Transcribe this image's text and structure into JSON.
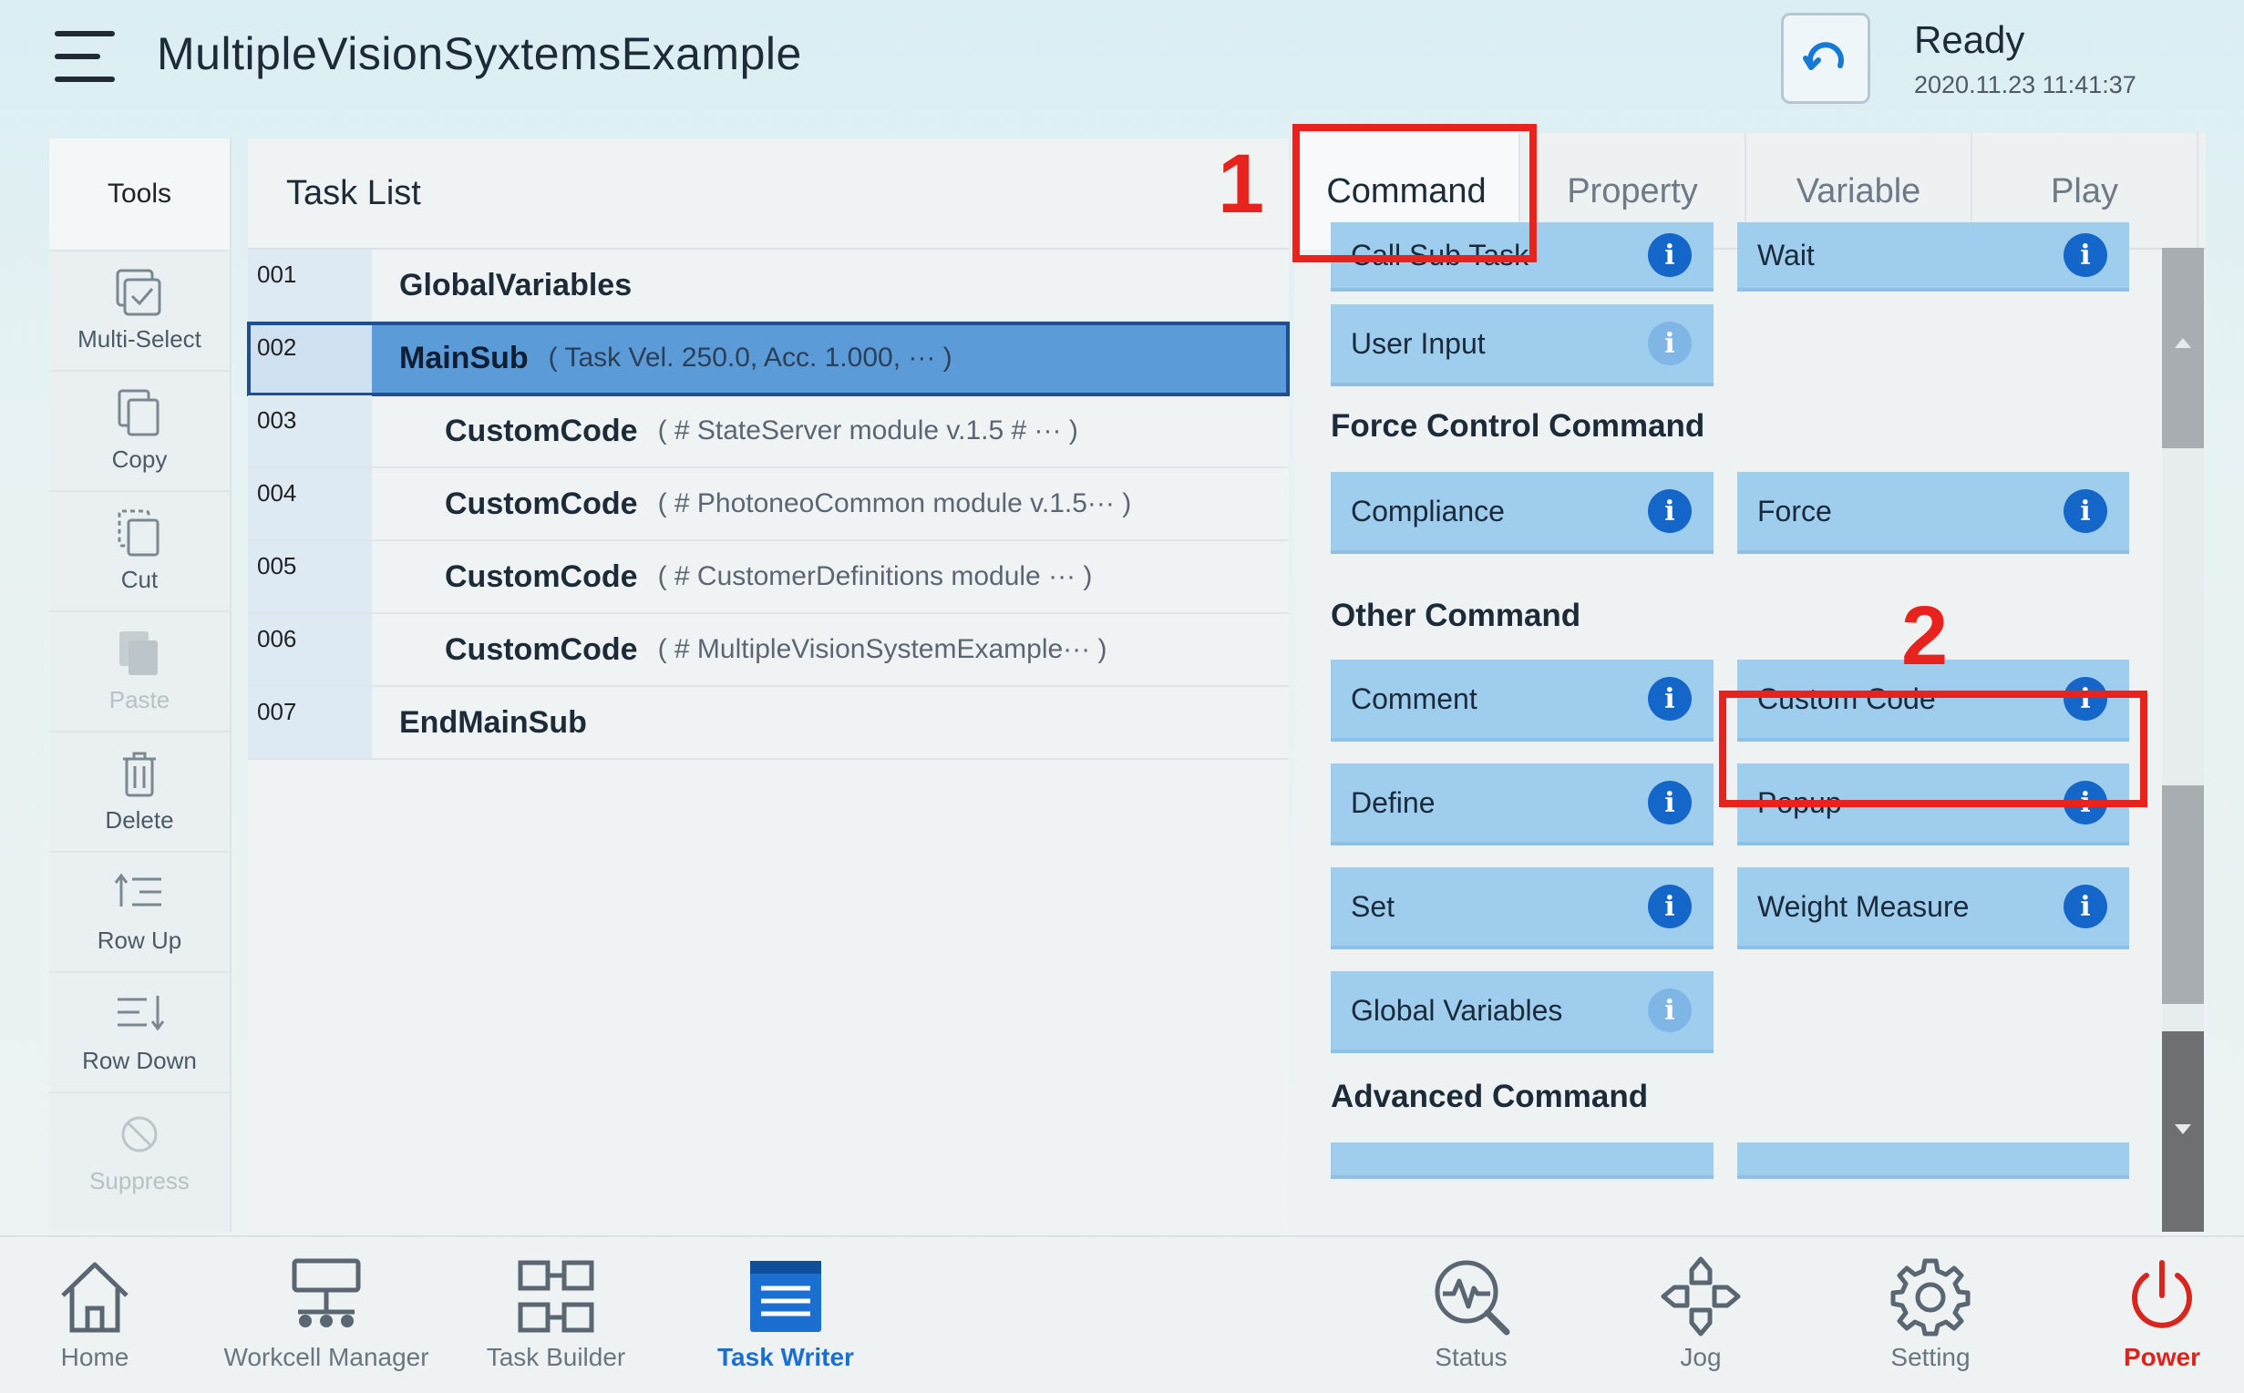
{
  "header": {
    "title": "MultipleVisionSyxtemsExample",
    "status": "Ready",
    "timestamp": "2020.11.23 11:41:37"
  },
  "tools": {
    "title": "Tools",
    "items": [
      {
        "label": "Multi-Select",
        "icon": "multi-select-icon",
        "enabled": true
      },
      {
        "label": "Copy",
        "icon": "copy-icon",
        "enabled": true
      },
      {
        "label": "Cut",
        "icon": "cut-icon",
        "enabled": true
      },
      {
        "label": "Paste",
        "icon": "paste-icon",
        "enabled": false
      },
      {
        "label": "Delete",
        "icon": "delete-icon",
        "enabled": true
      },
      {
        "label": "Row Up",
        "icon": "row-up-icon",
        "enabled": true
      },
      {
        "label": "Row Down",
        "icon": "row-down-icon",
        "enabled": true
      },
      {
        "label": "Suppress",
        "icon": "suppress-icon",
        "enabled": false
      }
    ]
  },
  "tasklist": {
    "title": "Task List",
    "rows": [
      {
        "num": "001",
        "name": "GlobalVariables",
        "detail": ""
      },
      {
        "num": "002",
        "name": "MainSub",
        "detail": "( Task Vel. 250.0, Acc. 1.000, ··· )"
      },
      {
        "num": "003",
        "name": "CustomCode",
        "detail": "( # StateServer module v.1.5 # ··· )"
      },
      {
        "num": "004",
        "name": "CustomCode",
        "detail": "( # PhotoneoCommon module v.1.5··· )"
      },
      {
        "num": "005",
        "name": "CustomCode",
        "detail": "( # CustomerDefinitions module ··· )"
      },
      {
        "num": "006",
        "name": "CustomCode",
        "detail": "( # MultipleVisionSystemExample··· )"
      },
      {
        "num": "007",
        "name": "EndMainSub",
        "detail": ""
      }
    ]
  },
  "tabs": [
    "Command",
    "Property",
    "Variable",
    "Play"
  ],
  "annotations": {
    "one": "1",
    "two": "2"
  },
  "commands": {
    "top": [
      "Call Sub Task",
      "Wait",
      "User Input"
    ],
    "force_title": "Force Control Command",
    "force": [
      "Compliance",
      "Force"
    ],
    "other_title": "Other Command",
    "other": [
      "Comment",
      "Custom Code",
      "Define",
      "Popup",
      "Set",
      "Weight Measure",
      "Global Variables"
    ],
    "advanced_title": "Advanced Command"
  },
  "nav": [
    "Home",
    "Workcell Manager",
    "Task Builder",
    "Task Writer",
    "Status",
    "Jog",
    "Setting",
    "Power"
  ],
  "colors": {
    "accent": "#1a6fd0",
    "callout": "#e8231d",
    "selected_row": "#5b9bd8",
    "command_button": "#9ecdee"
  }
}
